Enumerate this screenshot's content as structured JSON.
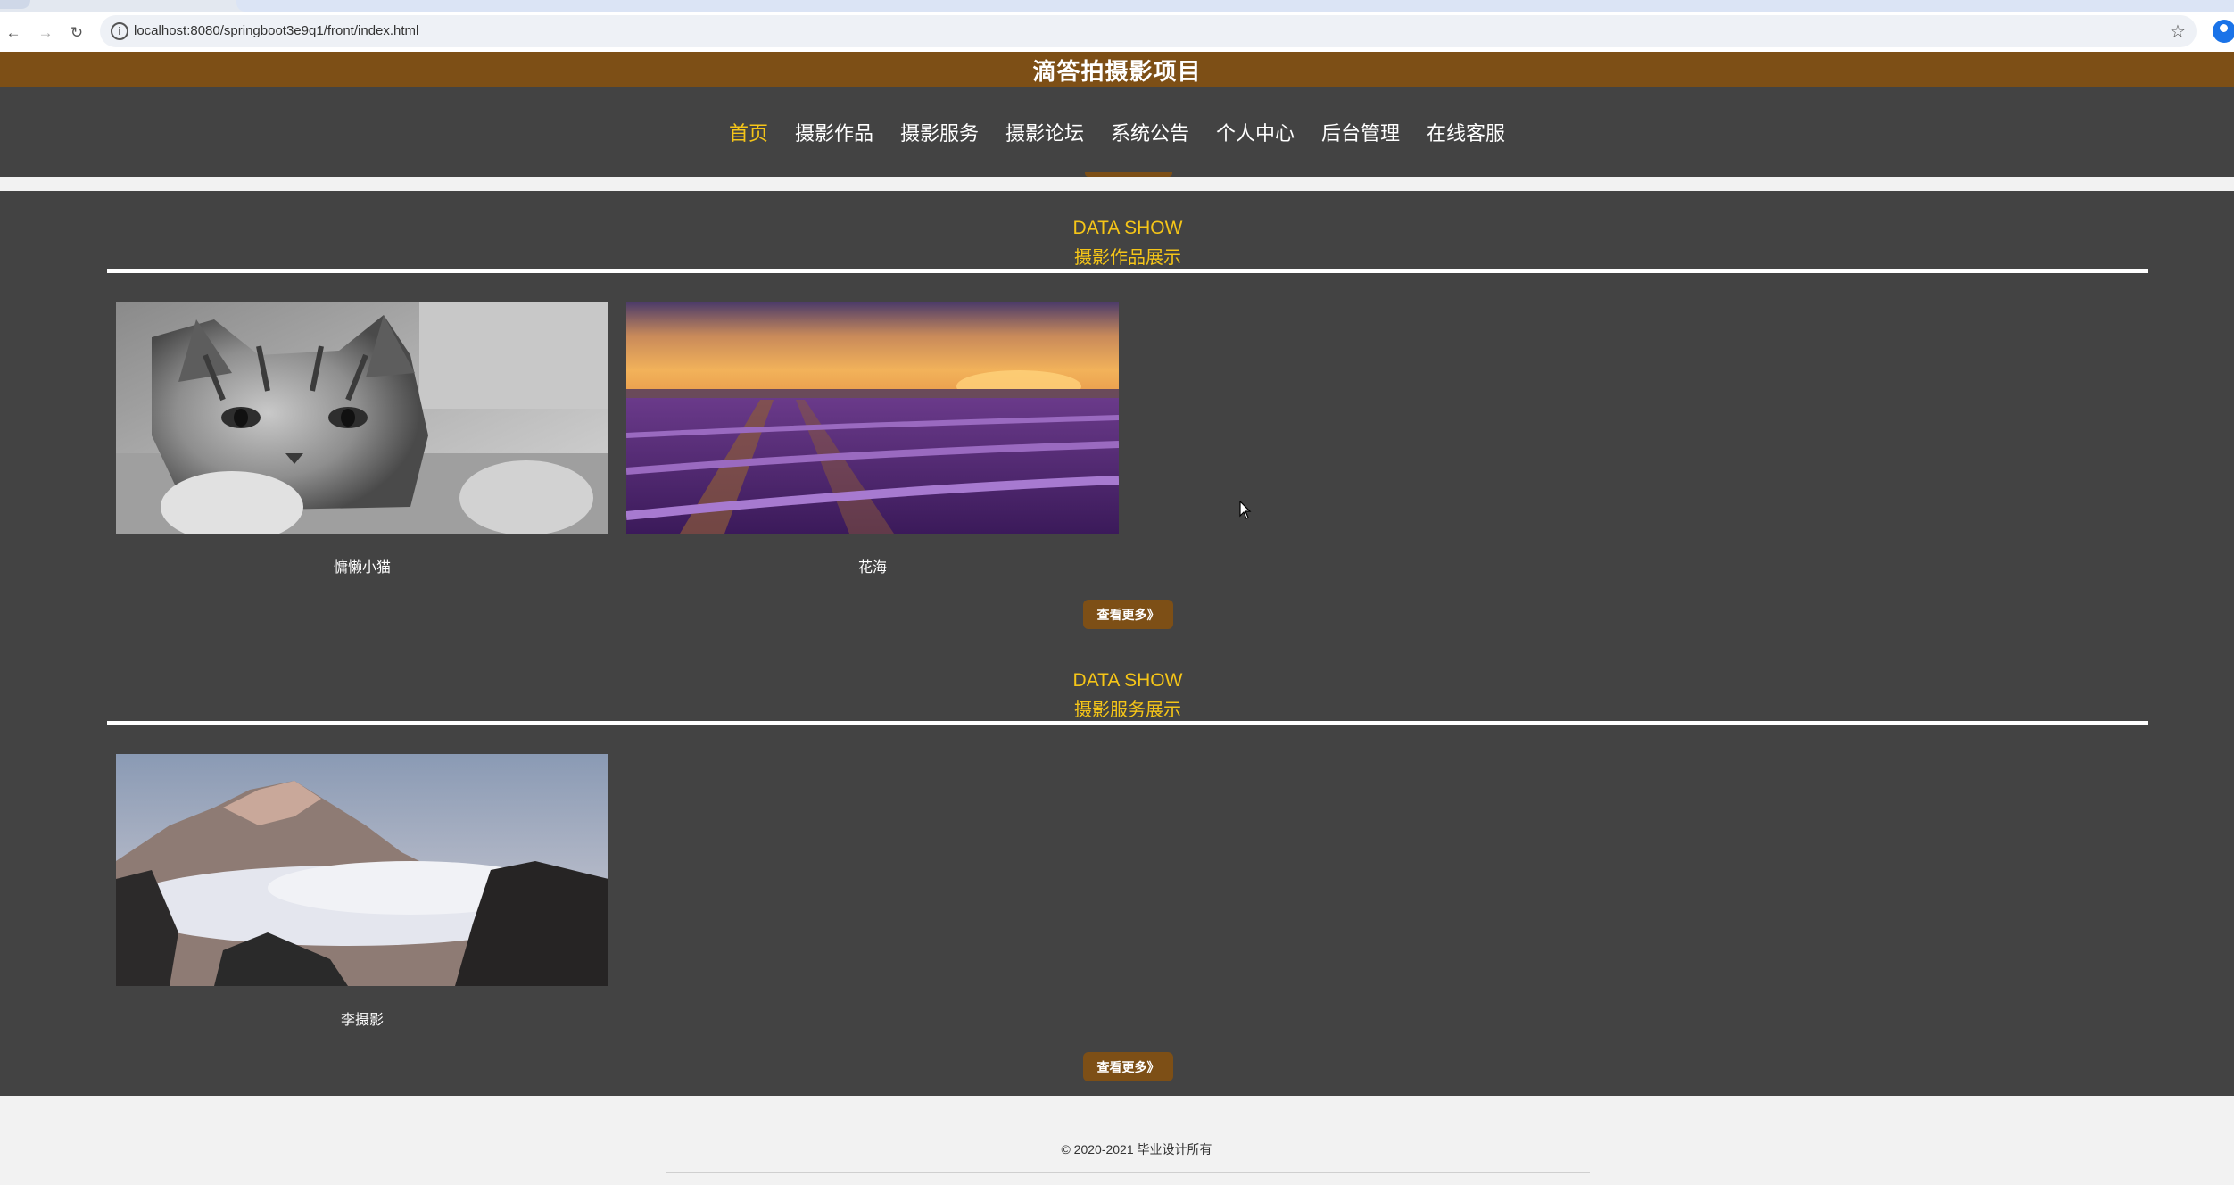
{
  "browser": {
    "url": "localhost:8080/springboot3e9q1/front/index.html",
    "back_icon": "arrow-left-icon",
    "forward_icon": "arrow-right-icon",
    "reload_icon": "reload-icon",
    "site_info_icon": "info-icon",
    "bookmark_icon": "star-icon",
    "profile_icon": "profile-icon"
  },
  "header": {
    "title": "滴答拍摄影项目",
    "brand_color": "#7d4f16"
  },
  "nav": {
    "items": [
      {
        "label": "首页",
        "active": true
      },
      {
        "label": "摄影作品",
        "active": false
      },
      {
        "label": "摄影服务",
        "active": false
      },
      {
        "label": "摄影论坛",
        "active": false
      },
      {
        "label": "系统公告",
        "active": false
      },
      {
        "label": "个人中心",
        "active": false
      },
      {
        "label": "后台管理",
        "active": false
      },
      {
        "label": "在线客服",
        "active": false
      }
    ],
    "active_color": "#f5c518"
  },
  "sections": [
    {
      "heading_en": "DATA SHOW",
      "heading_cn": "摄影作品展示",
      "items": [
        {
          "title": "慵懒小猫",
          "image": "cat-photo"
        },
        {
          "title": "花海",
          "image": "lavender-field-photo"
        }
      ],
      "more_label": "查看更多》"
    },
    {
      "heading_en": "DATA SHOW",
      "heading_cn": "摄影服务展示",
      "items": [
        {
          "title": "李摄影",
          "image": "mountain-clouds-photo"
        }
      ],
      "more_label": "查看更多》"
    }
  ],
  "footer": {
    "copyright": "© 2020-2021 毕业设计所有"
  }
}
